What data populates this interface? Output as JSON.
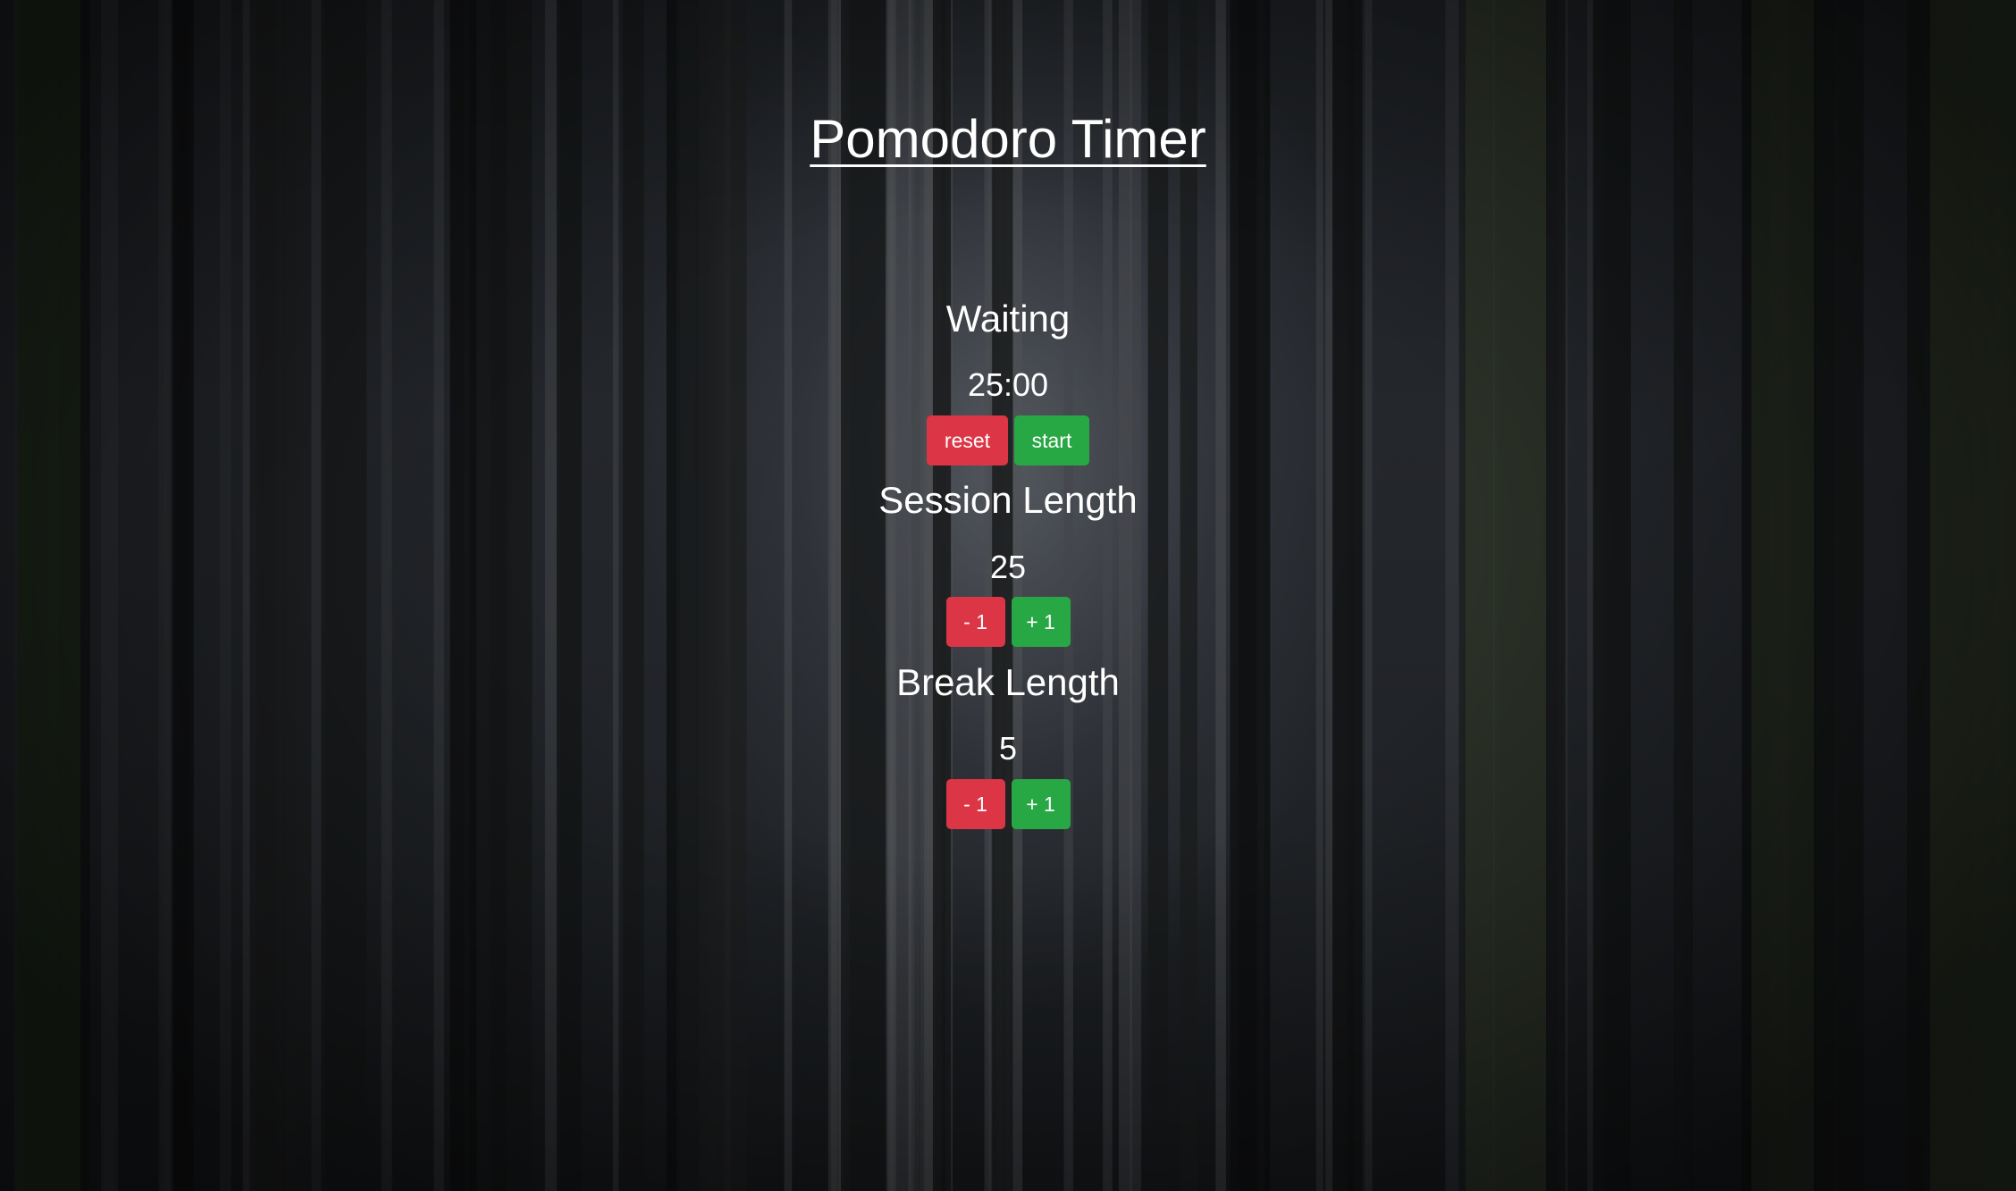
{
  "title": "Pomodoro Timer",
  "timer": {
    "status": "Waiting",
    "time": "25:00",
    "reset_label": "reset",
    "start_label": "start"
  },
  "session": {
    "label": "Session Length",
    "value": "25",
    "decrement_label": "- 1",
    "increment_label": "+ 1"
  },
  "break": {
    "label": "Break Length",
    "value": "5",
    "decrement_label": "- 1",
    "increment_label": "+ 1"
  },
  "colors": {
    "danger": "#dc3545",
    "success": "#28a745",
    "text": "#ffffff"
  },
  "background": "dark-forest-photo"
}
